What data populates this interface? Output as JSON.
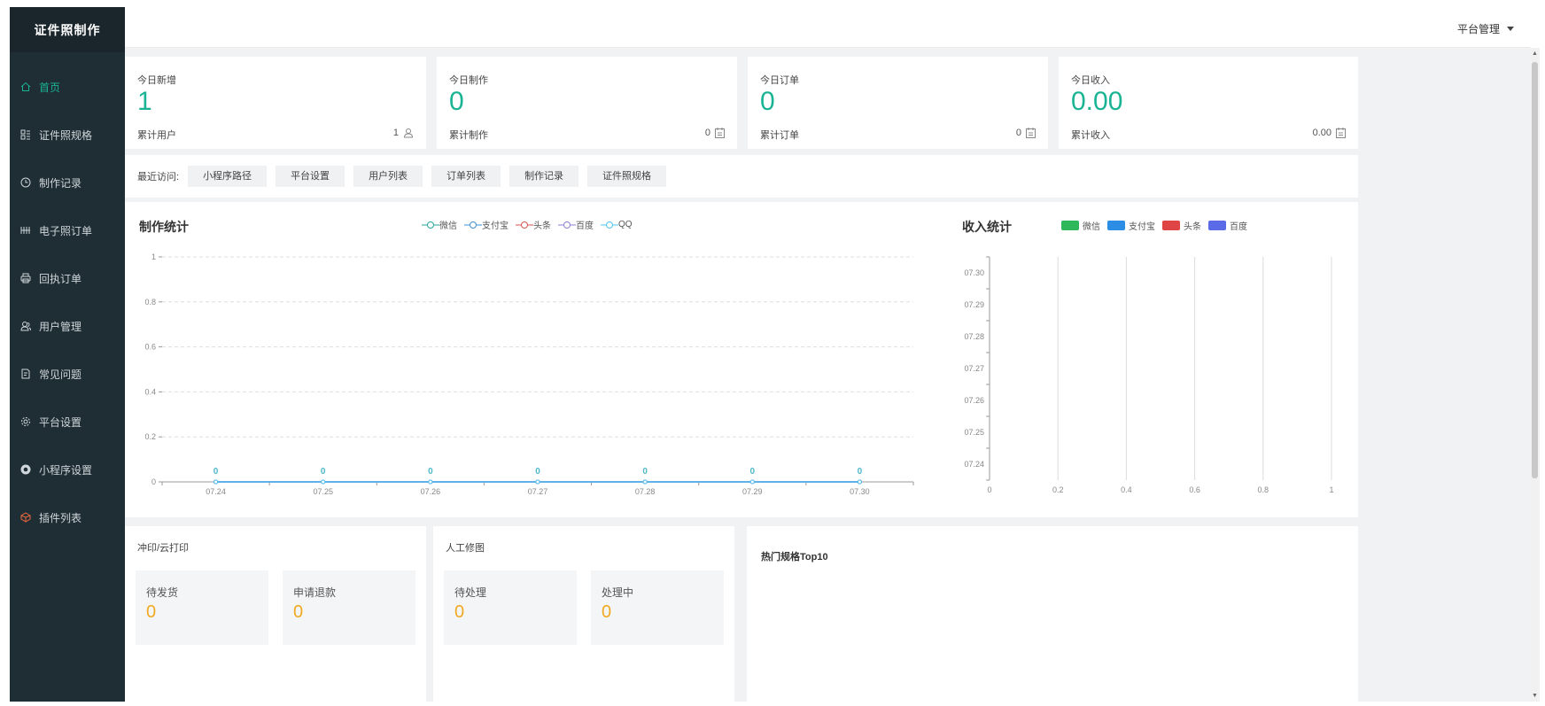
{
  "app": {
    "logo": "证件照制作",
    "admin_label": "平台管理"
  },
  "sidebar": {
    "items": [
      {
        "label": "首页",
        "icon": "home-icon"
      },
      {
        "label": "证件照规格",
        "icon": "spec-icon"
      },
      {
        "label": "制作记录",
        "icon": "clock-icon"
      },
      {
        "label": "电子照订单",
        "icon": "grid-icon"
      },
      {
        "label": "回执订单",
        "icon": "printer-icon"
      },
      {
        "label": "用户管理",
        "icon": "users-icon"
      },
      {
        "label": "常见问题",
        "icon": "question-doc-icon"
      },
      {
        "label": "平台设置",
        "icon": "gear-icon"
      },
      {
        "label": "小程序设置",
        "icon": "miniapp-icon"
      },
      {
        "label": "插件列表",
        "icon": "plugin-icon"
      }
    ]
  },
  "stats": [
    {
      "title": "今日新增",
      "value": "1",
      "total_label": "累计用户",
      "total_value": "1",
      "icon": "user-icon"
    },
    {
      "title": "今日制作",
      "value": "0",
      "total_label": "累计制作",
      "total_value": "0",
      "icon": "calendar-icon"
    },
    {
      "title": "今日订单",
      "value": "0",
      "total_label": "累计订单",
      "total_value": "0",
      "icon": "calendar-icon"
    },
    {
      "title": "今日收入",
      "value": "0.00",
      "total_label": "累计收入",
      "total_value": "0.00",
      "icon": "calendar-icon"
    }
  ],
  "recent": {
    "label": "最近访问:",
    "tags": [
      "小程序路径",
      "平台设置",
      "用户列表",
      "订单列表",
      "制作记录",
      "证件照规格"
    ]
  },
  "production_chart": {
    "title": "制作统计",
    "legend": [
      "微信",
      "支付宝",
      "头条",
      "百度",
      "QQ"
    ],
    "colors": [
      "#26a69a",
      "#3f8fd2",
      "#d9534f",
      "#8a7fd8",
      "#4fc3f7"
    ]
  },
  "income_chart": {
    "title": "收入统计",
    "legend": [
      "微信",
      "支付宝",
      "头条",
      "百度"
    ],
    "colors": [
      "#2eb85c",
      "#2b8de3",
      "#e04545",
      "#5b6be8"
    ]
  },
  "chart_data": [
    {
      "type": "line",
      "title": "制作统计",
      "categories": [
        "07.24",
        "07.25",
        "07.26",
        "07.27",
        "07.28",
        "07.29",
        "07.30"
      ],
      "ylim": [
        0,
        1
      ],
      "yticks": [
        "0",
        "0.2",
        "0.4",
        "0.6",
        "0.8",
        "1"
      ],
      "series": [
        {
          "name": "微信",
          "values": [
            0,
            0,
            0,
            0,
            0,
            0,
            0
          ]
        },
        {
          "name": "支付宝",
          "values": [
            0,
            0,
            0,
            0,
            0,
            0,
            0
          ]
        },
        {
          "name": "头条",
          "values": [
            0,
            0,
            0,
            0,
            0,
            0,
            0
          ]
        },
        {
          "name": "百度",
          "values": [
            0,
            0,
            0,
            0,
            0,
            0,
            0
          ]
        },
        {
          "name": "QQ",
          "values": [
            0,
            0,
            0,
            0,
            0,
            0,
            0
          ]
        }
      ],
      "data_labels": [
        "0",
        "0",
        "0",
        "0",
        "0",
        "0",
        "0"
      ],
      "grid": true,
      "legend": "top"
    },
    {
      "type": "bar",
      "orientation": "horizontal",
      "title": "收入统计",
      "categories": [
        "07.24",
        "07.25",
        "07.26",
        "07.27",
        "07.28",
        "07.29",
        "07.30"
      ],
      "xlim": [
        0,
        1
      ],
      "xticks": [
        "0",
        "0.2",
        "0.4",
        "0.6",
        "0.8",
        "1"
      ],
      "series": [
        {
          "name": "微信",
          "values": [
            0,
            0,
            0,
            0,
            0,
            0,
            0
          ]
        },
        {
          "name": "支付宝",
          "values": [
            0,
            0,
            0,
            0,
            0,
            0,
            0
          ]
        },
        {
          "name": "头条",
          "values": [
            0,
            0,
            0,
            0,
            0,
            0,
            0
          ]
        },
        {
          "name": "百度",
          "values": [
            0,
            0,
            0,
            0,
            0,
            0,
            0
          ]
        }
      ],
      "legend": "top"
    }
  ],
  "print_section": {
    "title": "冲印/云打印",
    "items": [
      {
        "label": "待发货",
        "value": "0"
      },
      {
        "label": "申请退款",
        "value": "0"
      }
    ]
  },
  "retouch_section": {
    "title": "人工修图",
    "items": [
      {
        "label": "待处理",
        "value": "0"
      },
      {
        "label": "处理中",
        "value": "0"
      }
    ]
  },
  "hot_specs": {
    "title": "热门规格Top10"
  }
}
